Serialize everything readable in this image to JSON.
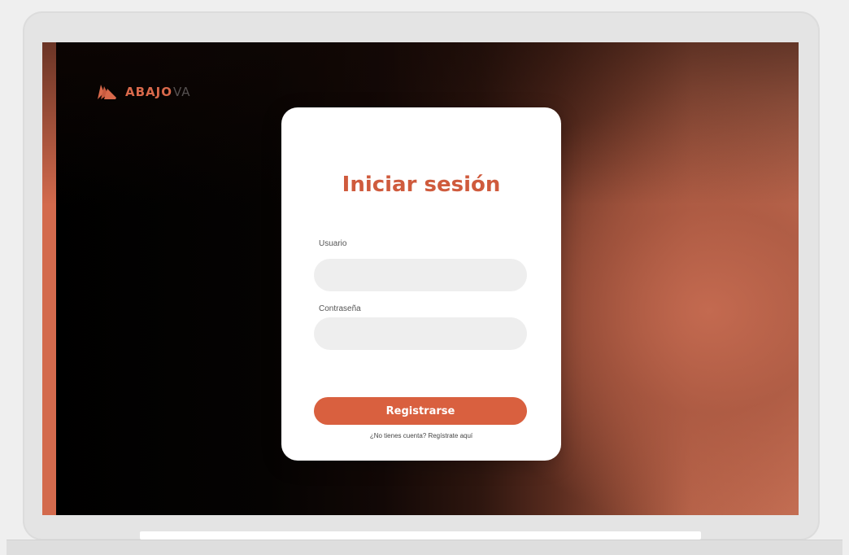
{
  "colors": {
    "accent": "#d9603f",
    "title": "#cf5b3d",
    "input_bg": "#eeeeee",
    "card_bg": "#ffffff"
  },
  "brand": {
    "logo_icon": "wing-logo-icon",
    "name": "ABAJO",
    "suffix": "VA"
  },
  "login": {
    "title": "Iniciar sesión",
    "username": {
      "label": "Usuario",
      "value": "",
      "placeholder": ""
    },
    "password": {
      "label": "Contraseña",
      "value": "",
      "placeholder": ""
    },
    "submit_label": "Registrarse",
    "signup_text": "¿No tienes cuenta? Regístrate aquí"
  }
}
